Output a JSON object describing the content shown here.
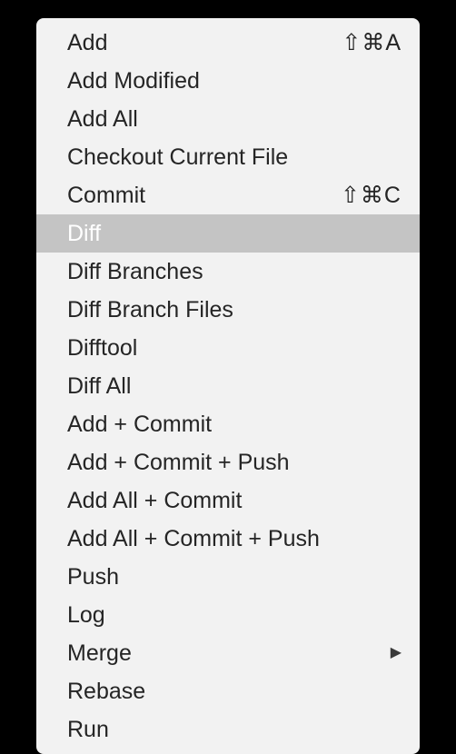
{
  "menu": {
    "items": [
      {
        "label": "Add",
        "shortcut": "⇧⌘A",
        "hasSubmenu": false,
        "highlighted": false
      },
      {
        "label": "Add Modified",
        "shortcut": "",
        "hasSubmenu": false,
        "highlighted": false
      },
      {
        "label": "Add All",
        "shortcut": "",
        "hasSubmenu": false,
        "highlighted": false
      },
      {
        "label": "Checkout Current File",
        "shortcut": "",
        "hasSubmenu": false,
        "highlighted": false
      },
      {
        "label": "Commit",
        "shortcut": "⇧⌘C",
        "hasSubmenu": false,
        "highlighted": false
      },
      {
        "label": "Diff",
        "shortcut": "",
        "hasSubmenu": false,
        "highlighted": true
      },
      {
        "label": "Diff Branches",
        "shortcut": "",
        "hasSubmenu": false,
        "highlighted": false
      },
      {
        "label": "Diff Branch Files",
        "shortcut": "",
        "hasSubmenu": false,
        "highlighted": false
      },
      {
        "label": "Difftool",
        "shortcut": "",
        "hasSubmenu": false,
        "highlighted": false
      },
      {
        "label": "Diff All",
        "shortcut": "",
        "hasSubmenu": false,
        "highlighted": false
      },
      {
        "label": "Add + Commit",
        "shortcut": "",
        "hasSubmenu": false,
        "highlighted": false
      },
      {
        "label": "Add + Commit + Push",
        "shortcut": "",
        "hasSubmenu": false,
        "highlighted": false
      },
      {
        "label": "Add All + Commit",
        "shortcut": "",
        "hasSubmenu": false,
        "highlighted": false
      },
      {
        "label": "Add All + Commit + Push",
        "shortcut": "",
        "hasSubmenu": false,
        "highlighted": false
      },
      {
        "label": "Push",
        "shortcut": "",
        "hasSubmenu": false,
        "highlighted": false
      },
      {
        "label": "Log",
        "shortcut": "",
        "hasSubmenu": false,
        "highlighted": false
      },
      {
        "label": "Merge",
        "shortcut": "",
        "hasSubmenu": true,
        "highlighted": false
      },
      {
        "label": "Rebase",
        "shortcut": "",
        "hasSubmenu": false,
        "highlighted": false
      },
      {
        "label": "Run",
        "shortcut": "",
        "hasSubmenu": false,
        "highlighted": false
      }
    ]
  }
}
